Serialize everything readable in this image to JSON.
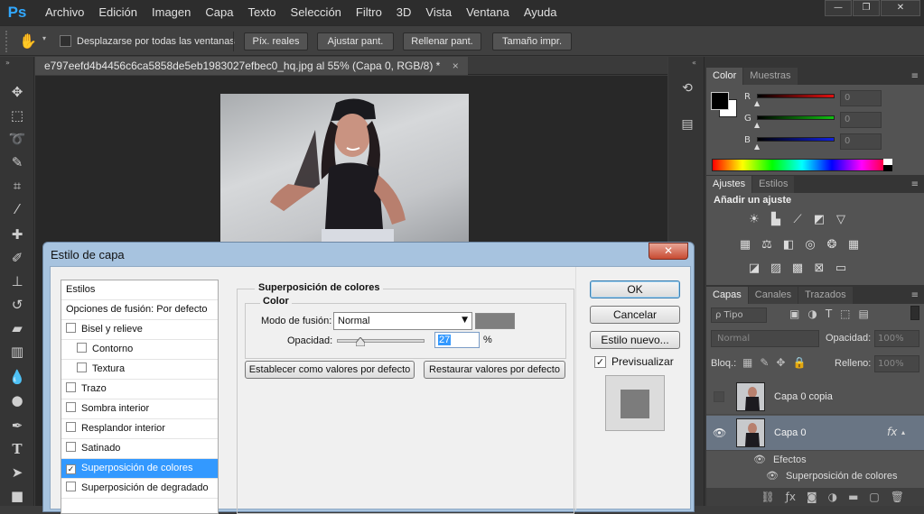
{
  "app": {
    "logo": "Ps"
  },
  "menu": [
    "Archivo",
    "Edición",
    "Imagen",
    "Capa",
    "Texto",
    "Selección",
    "Filtro",
    "3D",
    "Vista",
    "Ventana",
    "Ayuda"
  ],
  "window_controls": {
    "minimize": "—",
    "restore": "❐",
    "close": "✕"
  },
  "options_bar": {
    "scroll_all_label": "Desplazarse por todas las ventanas",
    "buttons": [
      "Píx. reales",
      "Ajustar pant.",
      "Rellenar pant.",
      "Tamaño impr."
    ]
  },
  "document": {
    "tab_title": "e797eefd4b4456c6ca5858de5eb1983027efbec0_hq.jpg al 55% (Capa 0, RGB/8) *",
    "close": "×"
  },
  "color_panel": {
    "tabs": [
      "Color",
      "Muestras"
    ],
    "channels": [
      {
        "label": "R",
        "value": "0",
        "color": "#e01010"
      },
      {
        "label": "G",
        "value": "0",
        "color": "#10c010"
      },
      {
        "label": "B",
        "value": "0",
        "color": "#1020e0"
      }
    ]
  },
  "adjustments_panel": {
    "tabs": [
      "Ajustes",
      "Estilos"
    ],
    "heading": "Añadir un ajuste"
  },
  "layers_panel": {
    "tabs": [
      "Capas",
      "Canales",
      "Trazados"
    ],
    "filter_kind": "ρ Tipo",
    "blend_mode": "Normal",
    "opacity_label": "Opacidad:",
    "opacity_value": "100%",
    "lock_label": "Bloq.:",
    "fill_label": "Relleno:",
    "fill_value": "100%",
    "layers": [
      {
        "name": "Capa 0 copia"
      },
      {
        "name": "Capa 0",
        "fx": "fx"
      }
    ],
    "effects_label": "Efectos",
    "effect_item": "Superposición de colores"
  },
  "dialog": {
    "title": "Estilo de capa",
    "close": "✕",
    "style_list": [
      {
        "label": "Estilos",
        "checkbox": false,
        "indent": false
      },
      {
        "label": "Opciones de fusión: Por defecto",
        "checkbox": false,
        "indent": false
      },
      {
        "label": "Bisel y relieve",
        "checkbox": true,
        "checked": false,
        "indent": false
      },
      {
        "label": "Contorno",
        "checkbox": true,
        "checked": false,
        "indent": true
      },
      {
        "label": "Textura",
        "checkbox": true,
        "checked": false,
        "indent": true
      },
      {
        "label": "Trazo",
        "checkbox": true,
        "checked": false,
        "indent": false
      },
      {
        "label": "Sombra interior",
        "checkbox": true,
        "checked": false,
        "indent": false
      },
      {
        "label": "Resplandor interior",
        "checkbox": true,
        "checked": false,
        "indent": false
      },
      {
        "label": "Satinado",
        "checkbox": true,
        "checked": false,
        "indent": false
      },
      {
        "label": "Superposición de colores",
        "checkbox": true,
        "checked": true,
        "indent": false,
        "selected": true
      },
      {
        "label": "Superposición de degradado",
        "checkbox": true,
        "checked": false,
        "indent": false
      }
    ],
    "section_title": "Superposición de colores",
    "subsection_title": "Color",
    "blend_label": "Modo de fusión:",
    "blend_value": "Normal",
    "overlay_color": "#7f7f7f",
    "opacity_label": "Opacidad:",
    "opacity_value": "27",
    "opacity_fraction": 0.27,
    "percent": "%",
    "btn_default": "Establecer como valores por defecto",
    "btn_restore": "Restaurar valores por defecto",
    "ok": "OK",
    "cancel": "Cancelar",
    "new_style": "Estilo nuevo...",
    "preview_label": "Previsualizar",
    "preview_checked": true
  }
}
